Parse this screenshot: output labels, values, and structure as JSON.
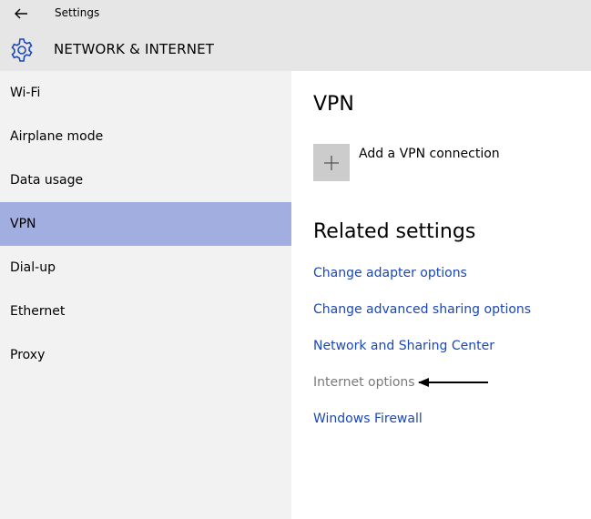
{
  "window": {
    "title": "Settings"
  },
  "header": {
    "title": "NETWORK & INTERNET",
    "icon": "gear-icon"
  },
  "sidebar": {
    "items": [
      {
        "label": "Wi-Fi",
        "selected": false
      },
      {
        "label": "Airplane mode",
        "selected": false
      },
      {
        "label": "Data usage",
        "selected": false
      },
      {
        "label": "VPN",
        "selected": true
      },
      {
        "label": "Dial-up",
        "selected": false
      },
      {
        "label": "Ethernet",
        "selected": false
      },
      {
        "label": "Proxy",
        "selected": false
      }
    ]
  },
  "main": {
    "title": "VPN",
    "add_vpn_label": "Add a VPN connection",
    "related_title": "Related settings",
    "links": [
      {
        "label": "Change adapter options",
        "enabled": true
      },
      {
        "label": "Change advanced sharing options",
        "enabled": true
      },
      {
        "label": "Network and Sharing Center",
        "enabled": true
      },
      {
        "label": "Internet options",
        "enabled": false
      },
      {
        "label": "Windows Firewall",
        "enabled": true
      }
    ]
  },
  "colors": {
    "accent_selected": "#a3aee0",
    "link": "#1a47b8",
    "disabled_link": "#7a7a7a",
    "header_bg": "#e6e6e6",
    "sidebar_bg": "#f2f2f2"
  }
}
